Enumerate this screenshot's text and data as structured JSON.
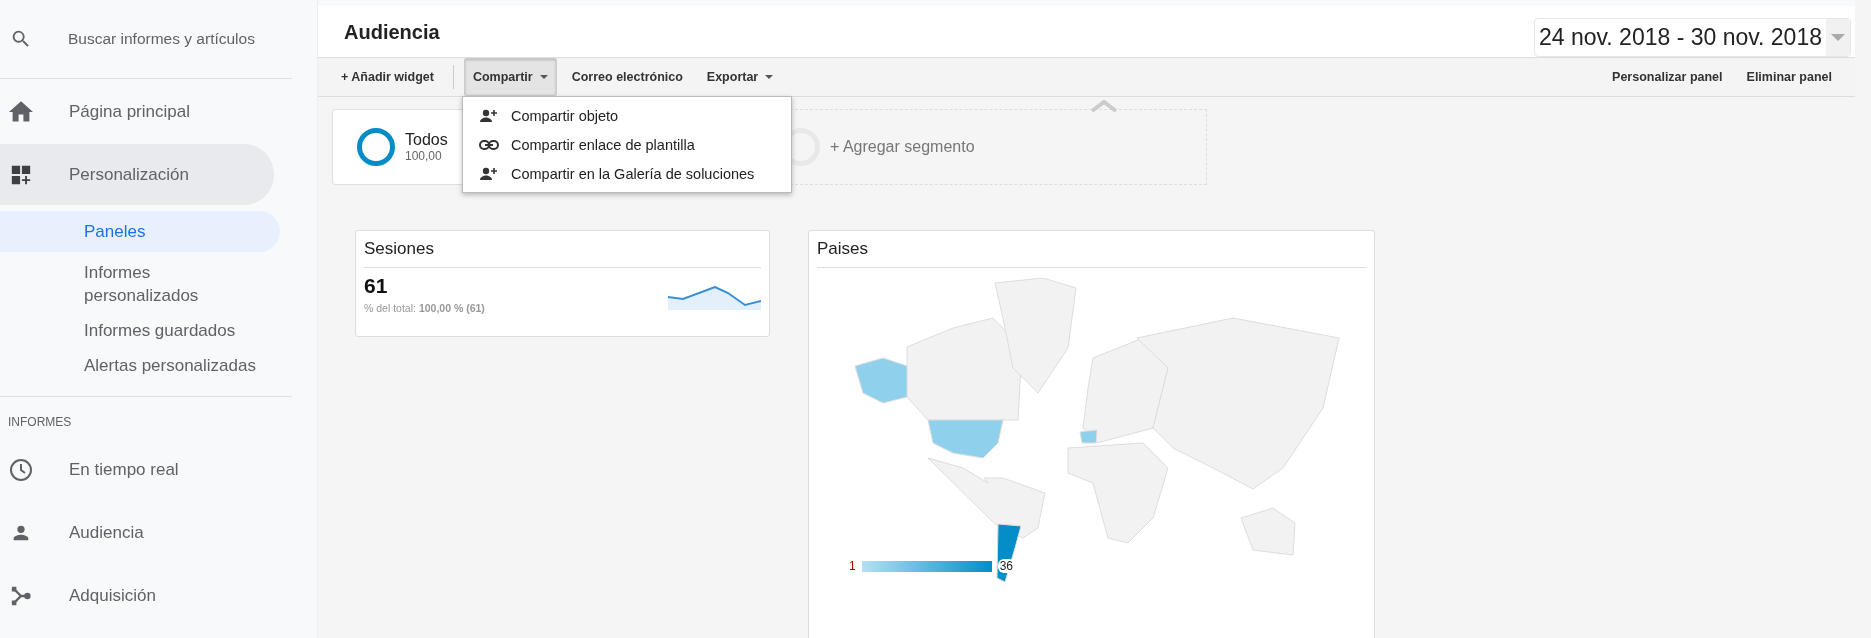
{
  "search": {
    "placeholder": "Buscar informes y artículos"
  },
  "sidebar": {
    "items": [
      {
        "kind": "nav",
        "label": "Página principal",
        "selected": false
      },
      {
        "kind": "nav",
        "label": "Personalización",
        "selected": false,
        "expanded": true,
        "children": [
          {
            "label": "Paneles",
            "selected": true
          },
          {
            "label": "Informes personalizados",
            "selected": false
          },
          {
            "label": "Informes guardados",
            "selected": false
          },
          {
            "label": "Alertas personalizadas",
            "selected": false
          }
        ]
      },
      {
        "kind": "section",
        "label": "INFORMES"
      },
      {
        "kind": "nav",
        "label": "En tiempo real",
        "selected": false
      },
      {
        "kind": "nav",
        "label": "Audiencia",
        "selected": false
      },
      {
        "kind": "nav",
        "label": "Adquisición",
        "selected": false
      }
    ]
  },
  "header": {
    "title": "Audiencia",
    "date_range": "24 nov. 2018 - 30 nov. 2018"
  },
  "toolbar": {
    "left": [
      {
        "kind": "plain",
        "label": "+ Añadir widget",
        "open": false
      },
      {
        "kind": "menu",
        "label": "Compartir",
        "open": true
      },
      {
        "kind": "plain",
        "label": "Correo electrónico",
        "open": false
      },
      {
        "kind": "menu",
        "label": "Exportar",
        "open": false
      }
    ],
    "right": [
      "Personalizar panel",
      "Eliminar panel"
    ]
  },
  "share_menu": {
    "items": [
      "Compartir objeto",
      "Compartir enlace de plantilla",
      "Compartir en la Galería de soluciones"
    ]
  },
  "segments": {
    "items": [
      {
        "name": "Todos",
        "value": "100,00"
      }
    ],
    "add_label": "+ Agregar segmento"
  },
  "widgets": [
    {
      "kind": "metric",
      "title": "Sesiones",
      "value": "61",
      "caption": "% del total: **100,00 % (61)**"
    },
    {
      "kind": "map",
      "title": "Paises",
      "legend_min": "1",
      "legend_max": "36"
    }
  ]
}
